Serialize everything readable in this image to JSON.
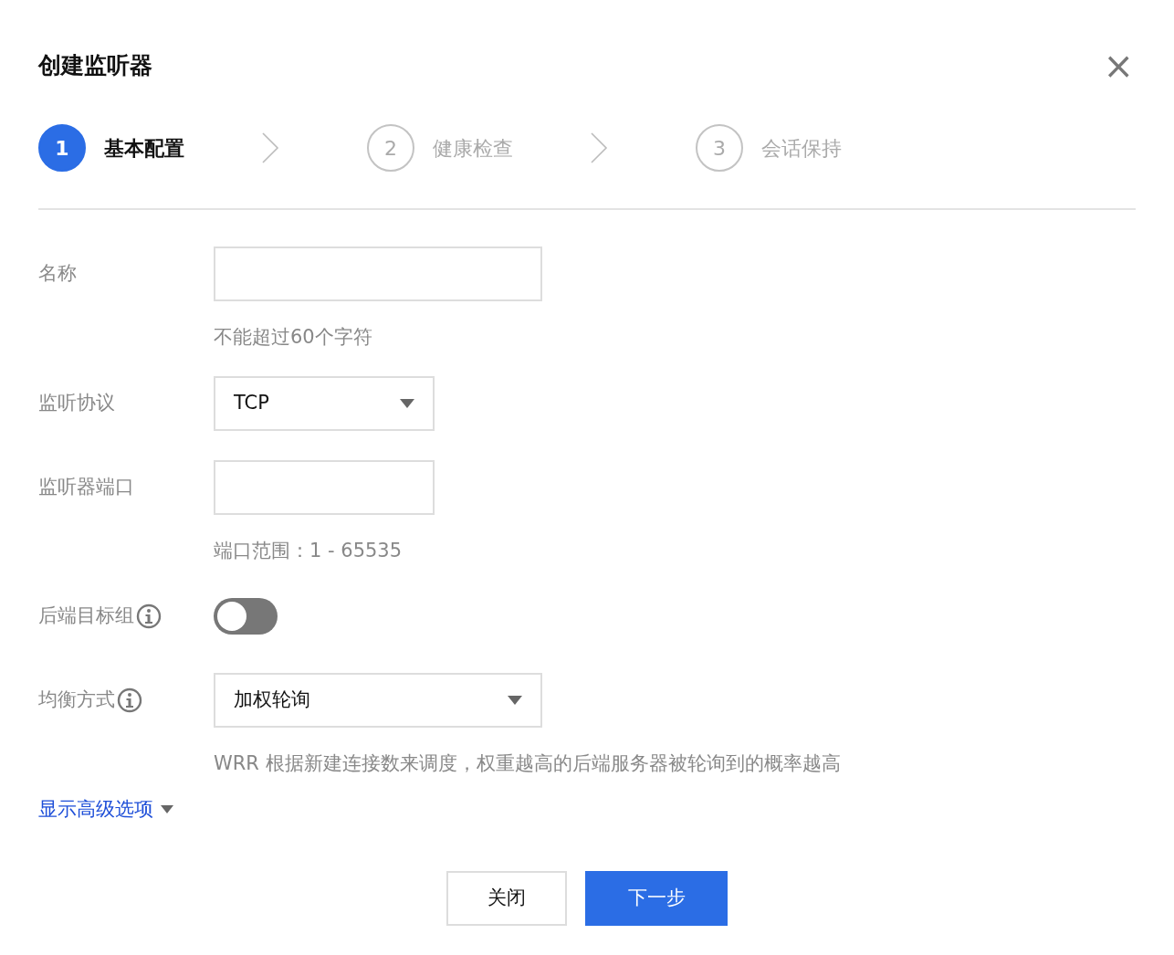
{
  "dialog": {
    "title": "创建监听器",
    "close": "×"
  },
  "steps": [
    {
      "number": "1",
      "label": "基本配置",
      "selected": true
    },
    {
      "number": "2",
      "label": "健康检查",
      "selected": false
    },
    {
      "number": "3",
      "label": "会话保持",
      "selected": false
    }
  ],
  "fields": [
    {
      "kind": "text",
      "label": "名称",
      "info": false,
      "hint": "不能超过60个字符"
    },
    {
      "kind": "select",
      "label": "监听协议",
      "info": false,
      "value": "TCP"
    },
    {
      "kind": "text",
      "label": "监听器端口",
      "info": false,
      "hint": "端口范围：1 - 65535"
    },
    {
      "kind": "toggle",
      "label": "后端目标组",
      "info": true,
      "on": false
    },
    {
      "kind": "select",
      "label": "均衡方式",
      "info": true,
      "value": "加权轮询",
      "hint": "WRR 根据新建连接数来调度，权重越高的后端服务器被轮询到的概率越高"
    }
  ],
  "advanced_link": "显示高级选项",
  "buttons": [
    {
      "label": "关闭",
      "kind": "secondary"
    },
    {
      "label": "下一步",
      "kind": "primary"
    }
  ]
}
